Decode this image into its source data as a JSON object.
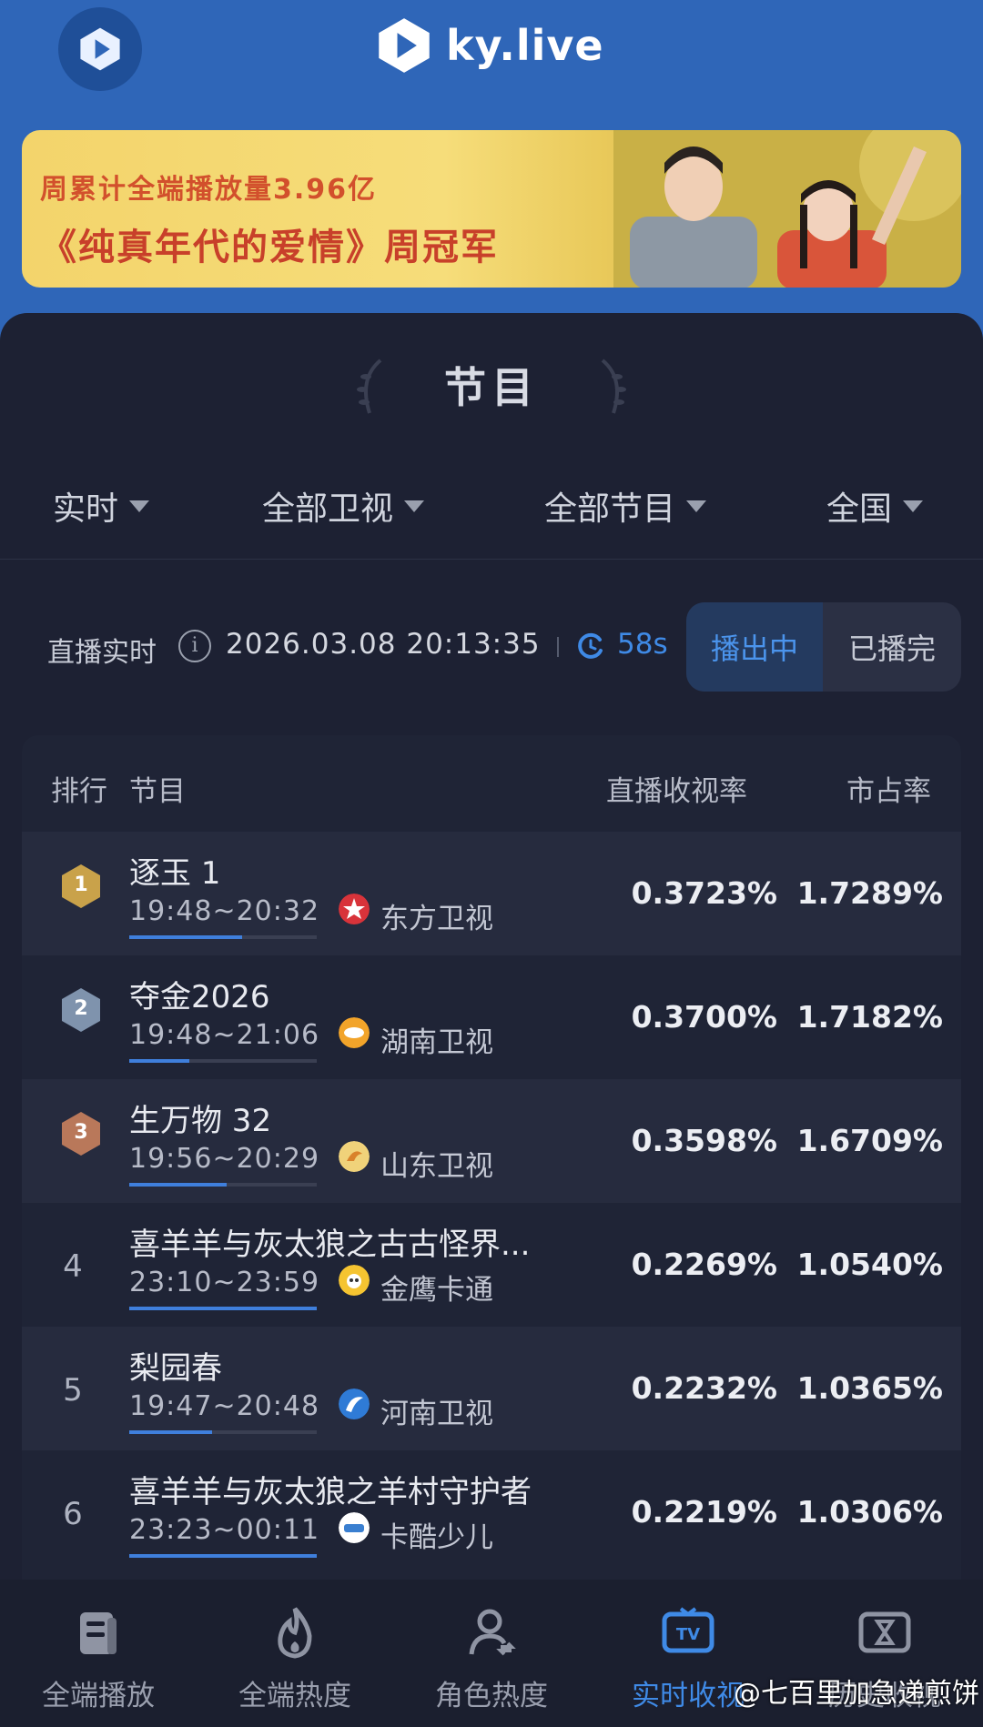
{
  "header": {
    "brand": "ky.live"
  },
  "banner": {
    "line1": "周累计全端播放量3.96亿",
    "line2": "《纯真年代的爱情》周冠军"
  },
  "section": {
    "title": "节目"
  },
  "filters": [
    {
      "label": "实时"
    },
    {
      "label": "全部卫视"
    },
    {
      "label": "全部节目"
    },
    {
      "label": "全国"
    }
  ],
  "live": {
    "label": "直播实时",
    "timestamp": "2026.03.08 20:13:35",
    "refresh": "58s",
    "toggle_on": "播出中",
    "toggle_off": "已播完"
  },
  "table": {
    "headers": {
      "rank": "排行",
      "program": "节目",
      "rating": "直播收视率",
      "share": "市占率"
    },
    "rows": [
      {
        "rank": "1",
        "name": "逐玉 1",
        "time": "19:48~20:32",
        "channel": "东方卫视",
        "rating": "0.3723%",
        "share": "1.7289%",
        "progress": 0.6
      },
      {
        "rank": "2",
        "name": "夺金2026",
        "time": "19:48~21:06",
        "channel": "湖南卫视",
        "rating": "0.3700%",
        "share": "1.7182%",
        "progress": 0.32
      },
      {
        "rank": "3",
        "name": "生万物 32",
        "time": "19:56~20:29",
        "channel": "山东卫视",
        "rating": "0.3598%",
        "share": "1.6709%",
        "progress": 0.52
      },
      {
        "rank": "4",
        "name": "喜羊羊与灰太狼之古古怪界...",
        "time": "23:10~23:59",
        "channel": "金鹰卡通",
        "rating": "0.2269%",
        "share": "1.0540%",
        "progress": 1.0
      },
      {
        "rank": "5",
        "name": "梨园春",
        "time": "19:47~20:48",
        "channel": "河南卫视",
        "rating": "0.2232%",
        "share": "1.0365%",
        "progress": 0.44
      },
      {
        "rank": "6",
        "name": "喜羊羊与灰太狼之羊村守护者",
        "time": "23:23~00:11",
        "channel": "卡酷少儿",
        "rating": "0.2219%",
        "share": "1.0306%",
        "progress": 1.0
      }
    ]
  },
  "bottom_nav": [
    {
      "label": "全端播放",
      "icon": "document-icon",
      "active": false
    },
    {
      "label": "全端热度",
      "icon": "flame-icon",
      "active": false
    },
    {
      "label": "角色热度",
      "icon": "person-icon",
      "active": false
    },
    {
      "label": "实时收视",
      "icon": "tv-icon",
      "active": true
    },
    {
      "label": "历史收视",
      "icon": "history-icon",
      "active": false
    }
  ],
  "credit": "@七百里加急递煎饼",
  "colors": {
    "accent": "#3f8ae6",
    "panel": "#1d2133",
    "header": "#2f66b8"
  }
}
